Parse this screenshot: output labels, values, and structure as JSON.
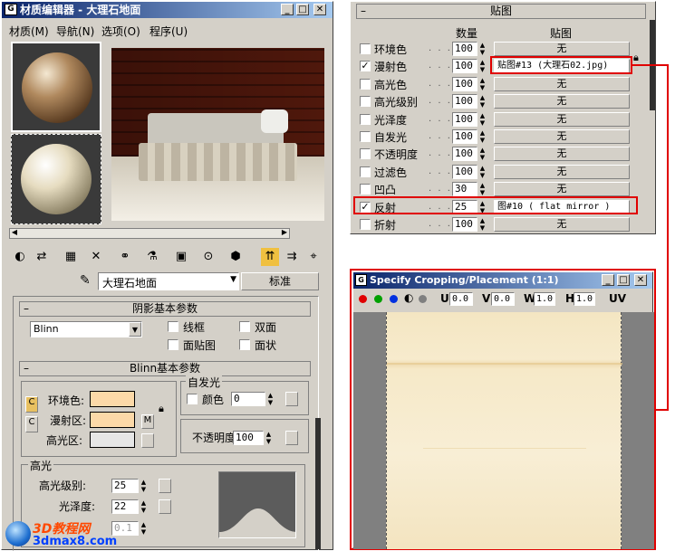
{
  "left": {
    "title": "材质编辑器 - 大理石地面",
    "menu": [
      "材质(M)",
      "导航(N)",
      "选项(O)",
      "程序(U)"
    ],
    "material_name": "大理石地面",
    "material_type_button": "标准",
    "shader": {
      "header": "阴影基本参数",
      "selected": "Blinn",
      "options": [
        {
          "label": "线框",
          "checked": false
        },
        {
          "label": "双面",
          "checked": false
        },
        {
          "label": "面贴图",
          "checked": false
        },
        {
          "label": "面状",
          "checked": false
        }
      ]
    },
    "blinn": {
      "header": "Blinn基本参数",
      "ambient_label": "环境色:",
      "diffuse_label": "漫射区:",
      "specular_label": "高光区:",
      "lock_label": "M",
      "self_illum_group": "自发光",
      "self_illum_color_label": "颜色",
      "self_illum_value": "0",
      "opacity_label": "不透明度",
      "opacity_value": "100",
      "highlight_group": "高光",
      "spec_level_label": "高光级别:",
      "spec_level_value": "25",
      "glossiness_label": "光泽度:",
      "glossiness_value": "22",
      "soften_value": "0.1"
    },
    "colors": {
      "ambient": "#fcd9a8",
      "diffuse": "#fcd9a8",
      "specular": "#e6e6e6"
    }
  },
  "maps": {
    "header": "贴图",
    "col_amount": "数量",
    "col_map": "贴图",
    "rows": [
      {
        "label": "环境色",
        "checked": false,
        "amount": "100",
        "map": "无"
      },
      {
        "label": "漫射色",
        "checked": true,
        "amount": "100",
        "map": "贴图#13 (大理石02.jpg)"
      },
      {
        "label": "高光色",
        "checked": false,
        "amount": "100",
        "map": "无"
      },
      {
        "label": "高光级别",
        "checked": false,
        "amount": "100",
        "map": "无"
      },
      {
        "label": "光泽度",
        "checked": false,
        "amount": "100",
        "map": "无"
      },
      {
        "label": "自发光",
        "checked": false,
        "amount": "100",
        "map": "无"
      },
      {
        "label": "不透明度",
        "checked": false,
        "amount": "100",
        "map": "无"
      },
      {
        "label": "过滤色",
        "checked": false,
        "amount": "100",
        "map": "无"
      },
      {
        "label": "凹凸",
        "checked": false,
        "amount": "30",
        "map": "无"
      },
      {
        "label": "反射",
        "checked": true,
        "amount": "25",
        "map": "图#10 ( flat mirror )"
      },
      {
        "label": "折射",
        "checked": false,
        "amount": "100",
        "map": "无"
      }
    ]
  },
  "crop": {
    "title": "Specify Cropping/Placement (1:1)",
    "u_label": "U",
    "u_value": "0.0",
    "v_label": "V",
    "v_value": "0.0",
    "w_label": "W",
    "w_value": "1.0",
    "h_label": "H",
    "h_value": "1.0",
    "uv_label": "UV"
  },
  "watermark": {
    "line1": "3D教程网",
    "line2": "3dmax8.com"
  }
}
